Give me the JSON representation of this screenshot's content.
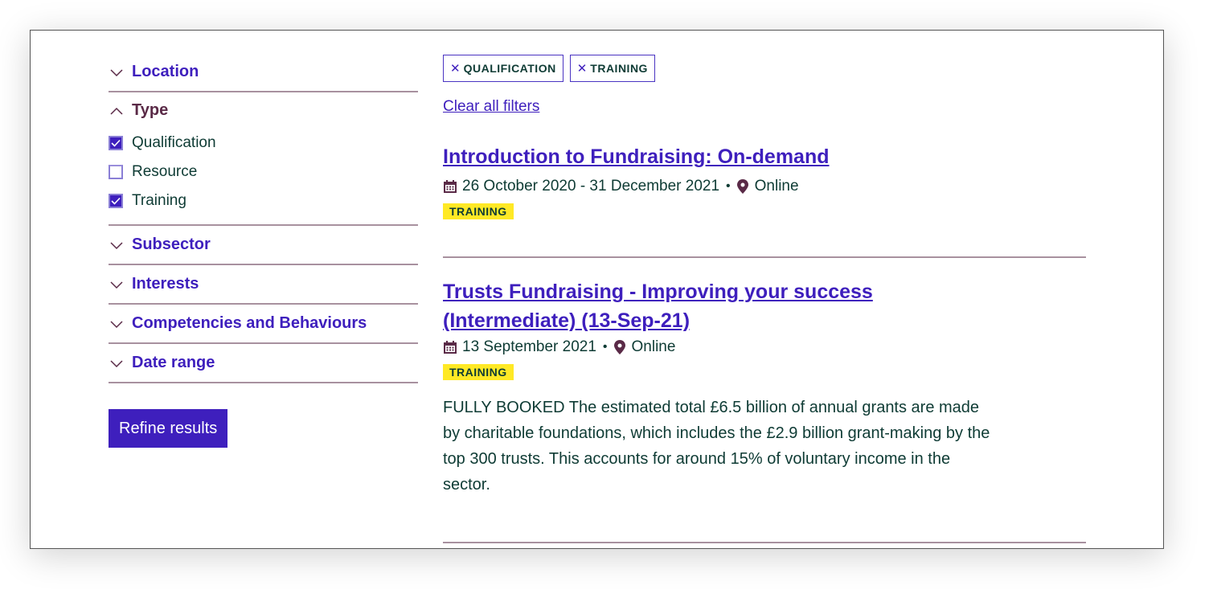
{
  "sidebar": {
    "facets": [
      {
        "title": "Location",
        "state": "collapsed",
        "icon": "chevron-down-icon"
      },
      {
        "title": "Type",
        "state": "expanded",
        "icon": "chevron-up-icon",
        "options": [
          {
            "label": "Qualification",
            "checked": true
          },
          {
            "label": "Resource",
            "checked": false
          },
          {
            "label": "Training",
            "checked": true
          }
        ]
      },
      {
        "title": "Subsector",
        "state": "collapsed",
        "icon": "chevron-down-icon"
      },
      {
        "title": "Interests",
        "state": "collapsed",
        "icon": "chevron-down-icon"
      },
      {
        "title": "Competencies and Behaviours",
        "state": "collapsed",
        "icon": "chevron-down-icon"
      },
      {
        "title": "Date range",
        "state": "collapsed",
        "icon": "chevron-down-icon"
      }
    ],
    "refine_label": "Refine results"
  },
  "main": {
    "active_filters": [
      {
        "label": "QUALIFICATION",
        "icon": "close-icon"
      },
      {
        "label": "TRAINING",
        "icon": "close-icon"
      }
    ],
    "clear_all_label": "Clear all filters",
    "results": [
      {
        "title": "Introduction to Fundraising: On-demand",
        "date": "26 October 2020 - 31 December 2021",
        "separator": "•",
        "location": "Online",
        "tag": "TRAINING"
      },
      {
        "title": "Trusts Fundraising - Improving your success (Intermediate) (13-Sep-21)",
        "date": "13 September 2021",
        "separator": "•",
        "location": "Online",
        "tag": "TRAINING",
        "description": "FULLY BOOKED The estimated total £6.5 billion of annual grants are made by charitable foundations, which includes the £2.9 billion grant-making by the top 300 trusts. This accounts for around 15% of voluntary income in the sector."
      }
    ]
  },
  "colors": {
    "accent": "#3e1fbd",
    "heading_active": "#5a2a47",
    "text": "#0e3b34",
    "divider": "#a8919f",
    "tag_bg": "#ffe925"
  }
}
